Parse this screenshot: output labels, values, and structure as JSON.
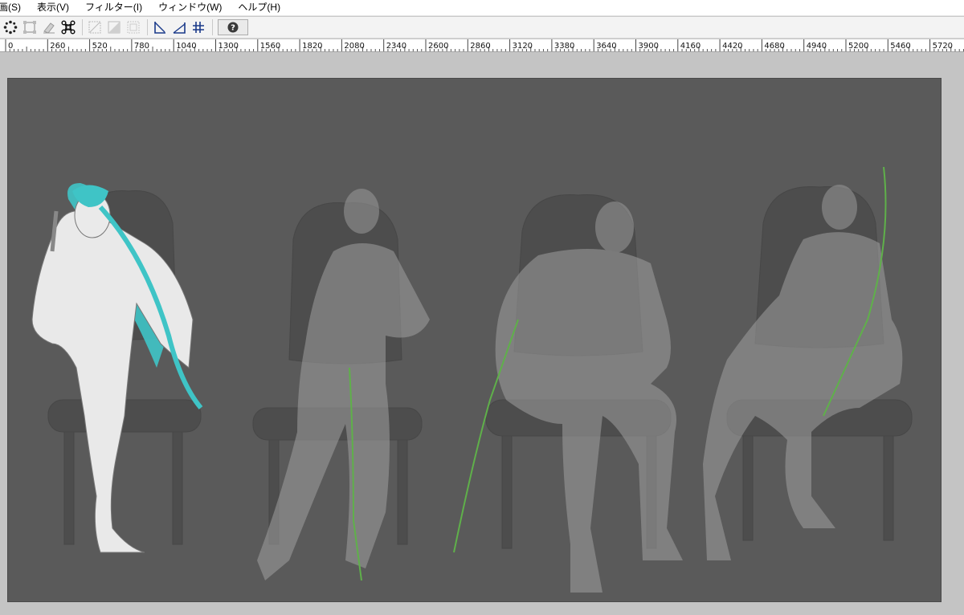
{
  "menu": {
    "items": [
      "画(S)",
      "表示(V)",
      "フィルター(I)",
      "ウィンドウ(W)",
      "ヘルプ(H)"
    ]
  },
  "toolbar": {
    "tools": [
      "move-points-icon",
      "transform-box-icon",
      "eraser-stroke-icon",
      "control-points-icon",
      "disabled-diagonal-icon",
      "disabled-fill-icon",
      "disabled-dotted-box-icon",
      "perspective-ruler-icon",
      "angle-ruler-icon",
      "grid-snap-icon"
    ],
    "help_icon": "question-icon"
  },
  "ruler": {
    "labels": [
      "0",
      "260",
      "520",
      "780",
      "1040",
      "1300",
      "1560",
      "1820",
      "2080",
      "2340",
      "2600",
      "2860",
      "3120",
      "3380",
      "3640",
      "3900",
      "4160",
      "4420",
      "4680",
      "4940",
      "5200",
      "5460",
      "5720"
    ]
  },
  "canvas": {
    "background": "#5a5a5a",
    "accent_hair": "#3fc4c6",
    "sword_green": "#5fb04a"
  }
}
